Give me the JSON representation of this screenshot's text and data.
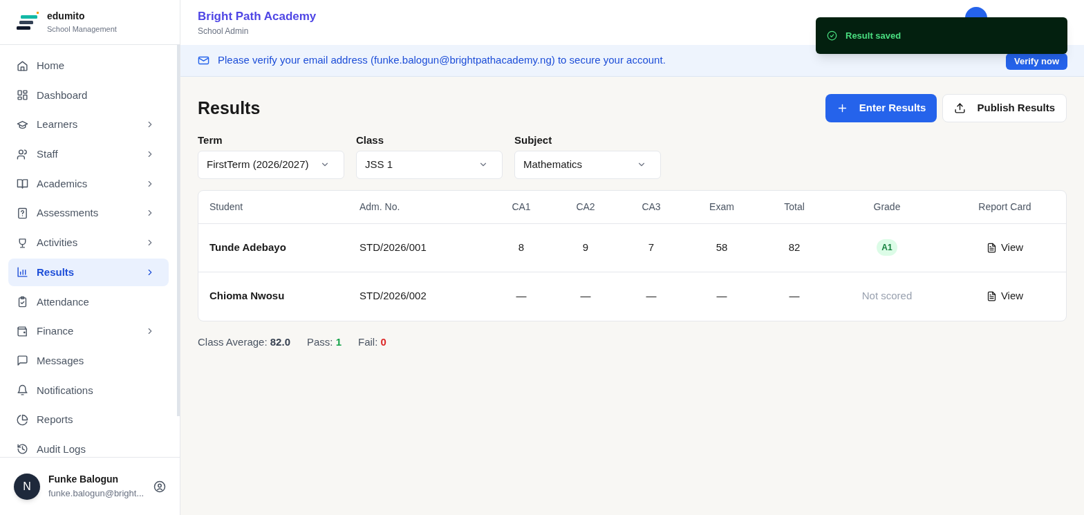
{
  "brand": {
    "name": "edumito",
    "tagline": "School Management"
  },
  "sidebar": {
    "items": [
      {
        "label": "Home",
        "expandable": false,
        "selected": false
      },
      {
        "label": "Dashboard",
        "expandable": false,
        "selected": false
      },
      {
        "label": "Learners",
        "expandable": true,
        "selected": false
      },
      {
        "label": "Staff",
        "expandable": true,
        "selected": false
      },
      {
        "label": "Academics",
        "expandable": true,
        "selected": false
      },
      {
        "label": "Assessments",
        "expandable": true,
        "selected": false
      },
      {
        "label": "Activities",
        "expandable": true,
        "selected": false
      },
      {
        "label": "Results",
        "expandable": true,
        "selected": true
      },
      {
        "label": "Attendance",
        "expandable": false,
        "selected": false
      },
      {
        "label": "Finance",
        "expandable": true,
        "selected": false
      },
      {
        "label": "Messages",
        "expandable": false,
        "selected": false
      },
      {
        "label": "Notifications",
        "expandable": false,
        "selected": false
      },
      {
        "label": "Reports",
        "expandable": false,
        "selected": false
      },
      {
        "label": "Audit Logs",
        "expandable": false,
        "selected": false
      }
    ],
    "user": {
      "initial": "N",
      "name": "Funke Balogun",
      "email": "funke.balogun@bright..."
    }
  },
  "header": {
    "school": "Bright Path Academy",
    "role": "School Admin"
  },
  "toast": {
    "message": "Result saved"
  },
  "banner": {
    "message": "Please verify your email address (funke.balogun@brightpathacademy.ng) to secure your account.",
    "action": "Verify now"
  },
  "page": {
    "title": "Results",
    "buttons": [
      {
        "label": "Enter Results",
        "kind": "primary"
      },
      {
        "label": "Publish Results",
        "kind": "secondary"
      }
    ]
  },
  "filters": [
    {
      "label": "Term",
      "value": "FirstTerm (2026/2027)"
    },
    {
      "label": "Class",
      "value": "JSS 1"
    },
    {
      "label": "Subject",
      "value": "Mathematics"
    }
  ],
  "table": {
    "columns": [
      "Student",
      "Adm. No.",
      "CA1",
      "CA2",
      "CA3",
      "Exam",
      "Total",
      "Grade",
      "Report Card"
    ],
    "rows": [
      {
        "student": "Tunde Adebayo",
        "adm_no": "STD/2026/001",
        "ca1": "8",
        "ca2": "9",
        "ca3": "7",
        "exam": "58",
        "total": "82",
        "grade": {
          "kind": "badge",
          "text": "A1"
        },
        "report": "View"
      },
      {
        "student": "Chioma Nwosu",
        "adm_no": "STD/2026/002",
        "ca1": "—",
        "ca2": "—",
        "ca3": "—",
        "exam": "—",
        "total": "—",
        "grade": {
          "kind": "empty",
          "text": "Not scored"
        },
        "report": "View"
      }
    ]
  },
  "summary": [
    {
      "label": "Class Average:",
      "value": "82.0",
      "kind": "neutral"
    },
    {
      "label": "Pass:",
      "value": "1",
      "kind": "pass"
    },
    {
      "label": "Fail:",
      "value": "0",
      "kind": "fail"
    }
  ]
}
